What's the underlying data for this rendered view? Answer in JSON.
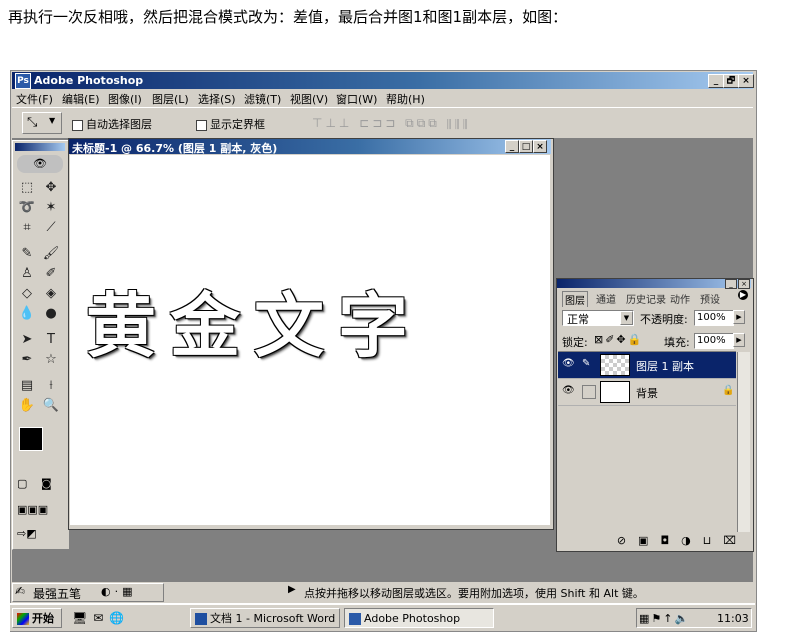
{
  "caption": "再执行一次反相哦，然后把混合模式改为：差值，最后合并图1和图1副本层，如图：",
  "app": {
    "title": "Adobe Photoshop",
    "window_buttons": [
      "_",
      "🗗",
      "×"
    ]
  },
  "menu": [
    "文件(F)",
    "编辑(E)",
    "图像(I)",
    "图层(L)",
    "选择(S)",
    "滤镜(T)",
    "视图(V)",
    "窗口(W)",
    "帮助(H)"
  ],
  "options": {
    "auto_select": "自动选择图层",
    "show_bounds": "显示定界框"
  },
  "document": {
    "title": "未标题-1 @ 66.7% (图层 1 副本, 灰色)",
    "canvas_text": "黄金文字"
  },
  "layers_panel": {
    "tabs": [
      "图层",
      "通道",
      "历史记录",
      "动作",
      "预设"
    ],
    "blend_mode": "正常",
    "opacity_label": "不透明度:",
    "opacity_value": "100%",
    "lock_label": "锁定:",
    "fill_label": "填充:",
    "fill_value": "100%",
    "layers": [
      {
        "name": "图层 1 副本",
        "selected": true
      },
      {
        "name": "背景",
        "selected": false
      }
    ]
  },
  "status": {
    "ime": "最强五笔",
    "hint": "点按并拖移以移动图层或选区。要用附加选项，使用 Shift 和 Alt 键。"
  },
  "taskbar": {
    "start": "开始",
    "word_task": "文档 1 - Microsoft Word",
    "ps_task": "Adobe Photoshop",
    "clock": "11:03"
  },
  "colors": {
    "selected_layer": "#0a246a",
    "titlebar": "#0a246a",
    "chrome": "#d4d0c8",
    "workspace": "#808080"
  }
}
